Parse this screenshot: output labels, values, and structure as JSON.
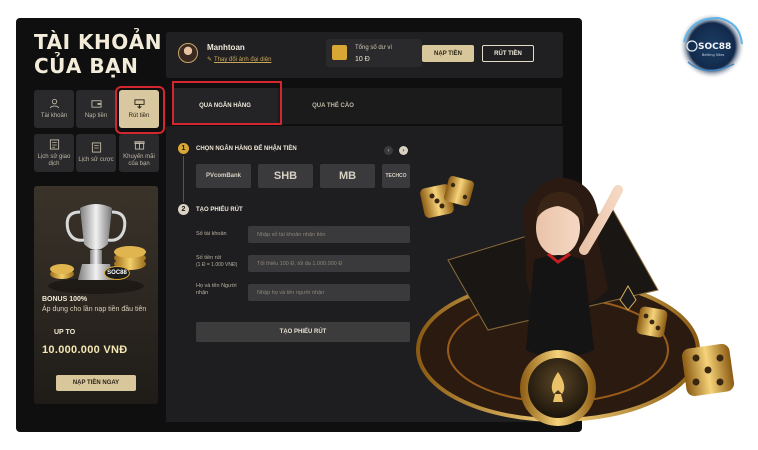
{
  "brand": {
    "name": "SOC88",
    "tagline": "Betting Sites",
    "accent": "#d9c79c",
    "highlight": "#d3262e"
  },
  "page_title": {
    "line1": "TÀI KHOẢN",
    "line2": "CỦA BẠN"
  },
  "menu": [
    {
      "label": "Tài khoản",
      "icon": "user-icon"
    },
    {
      "label": "Nạp tiền",
      "icon": "wallet-icon"
    },
    {
      "label": "Rút tiền",
      "icon": "cash-icon",
      "active": true
    },
    {
      "label": "Lịch sử giao dịch",
      "icon": "history-icon"
    },
    {
      "label": "Lịch sử cược",
      "icon": "bet-history-icon"
    },
    {
      "label": "Khuyến mãi của bạn",
      "icon": "gift-icon"
    }
  ],
  "promo": {
    "title": "BONUS 100%",
    "desc": "Áp dụng cho lần nạp tiền đầu tiên",
    "upto": "UP TO",
    "amount": "10.000.000 VNĐ",
    "button": "NẠP TIỀN NGAY",
    "badge": "SOC88"
  },
  "header": {
    "username": "Manhtoan",
    "change_avatar": "Thay đổi ảnh đại diện",
    "balance_label": "Tổng số dư ví",
    "balance_value": "10 Đ",
    "deposit": "NẠP TIỀN",
    "withdraw": "RÚT TIỀN"
  },
  "tabs": [
    {
      "label": "QUA NGÂN HÀNG",
      "active": true
    },
    {
      "label": "QUA THẺ CÀO",
      "active": false
    }
  ],
  "step1": {
    "num": "1",
    "title": "CHỌN NGÂN HÀNG ĐỂ NHẬN TIỀN"
  },
  "banks": [
    "PVcomBank",
    "SHB",
    "MB",
    "TECHCO"
  ],
  "step2": {
    "num": "2",
    "title": "TẠO PHIẾU RÚT"
  },
  "form": {
    "account_label": "Số tài khoản",
    "account_placeholder": "Nhập số tài khoản nhận tiền",
    "amount_label": "Số tiền rút",
    "amount_sub": "(1 Đ = 1.000 VNĐ)",
    "amount_placeholder": "Tối thiểu 100 Đ, tối đa 1.000.000 Đ",
    "name_label": "Họ và tên Người nhận",
    "name_placeholder": "Nhập họ và tên người nhận",
    "submit": "TẠO PHIẾU RÚT"
  }
}
